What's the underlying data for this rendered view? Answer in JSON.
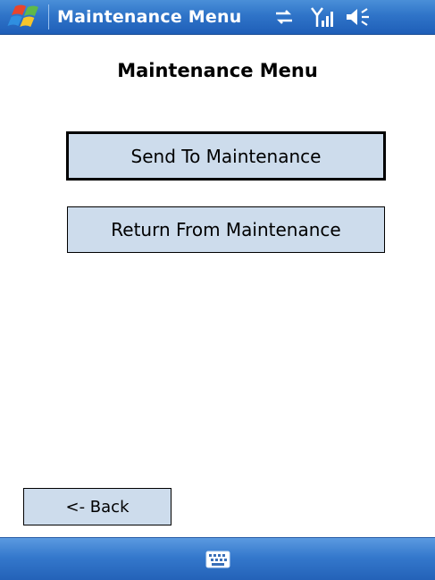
{
  "titlebar": {
    "title": "Maintenance Menu",
    "start_icon": "windows-start-flag-icon",
    "status_icons": [
      "sync-arrows-icon",
      "signal-strength-icon",
      "speaker-icon"
    ]
  },
  "main": {
    "heading": "Maintenance Menu",
    "buttons": {
      "send_label": "Send To Maintenance",
      "return_label": "Return From Maintenance",
      "back_label": "<- Back"
    }
  },
  "bottombar": {
    "input_icon": "keyboard-icon"
  },
  "colors": {
    "titlebar_blue": "#2f74c8",
    "button_fill": "#cddcec",
    "background": "#ffffff"
  }
}
